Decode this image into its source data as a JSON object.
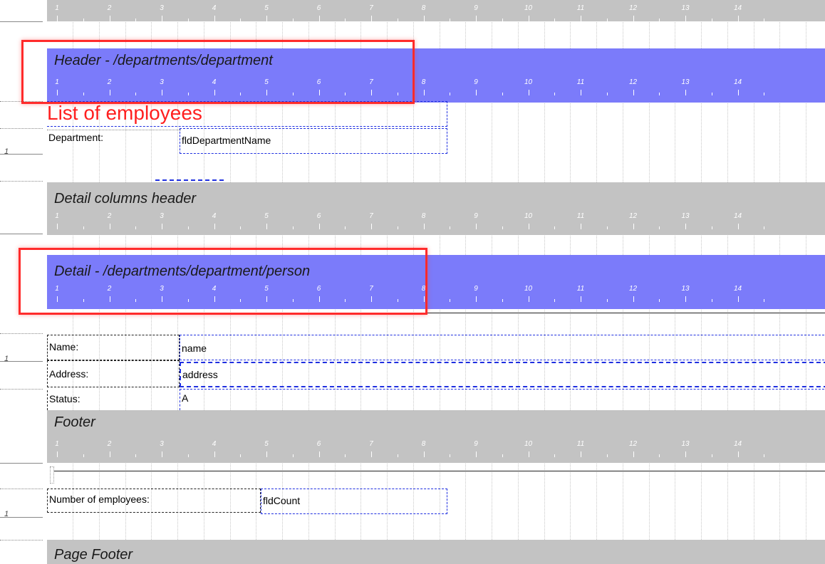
{
  "bands": {
    "header": {
      "title": "Header - /departments/department"
    },
    "detail_columns_header": {
      "title": "Detail columns header"
    },
    "detail": {
      "title": "Detail - /departments/department/person"
    },
    "footer": {
      "title": "Footer"
    },
    "page_footer": {
      "title": "Page Footer"
    }
  },
  "ruler_numbers": [
    "1",
    "2",
    "3",
    "4",
    "5",
    "6",
    "7",
    "8",
    "9",
    "10",
    "11",
    "12",
    "13",
    "14"
  ],
  "side_numbers": {
    "header": "1",
    "detail": "1",
    "footer": "1"
  },
  "header_fields": {
    "title_text": "List of employees",
    "department_label": "Department:",
    "department_value": "fldDepartmentName"
  },
  "detail_fields": {
    "name_label": "Name:",
    "name_value": "name",
    "address_label": "Address:",
    "address_value": "address",
    "status_label": "Status:",
    "status_value": "A"
  },
  "footer_fields": {
    "count_label": "Number of employees:",
    "count_value": "fldCount"
  },
  "colors": {
    "band_gray": "#c3c3c3",
    "band_blue": "#7b7bfa",
    "highlight_red": "#ff2b2b",
    "title_red": "#ff1f1f",
    "field_blue": "#1f2fe0"
  }
}
